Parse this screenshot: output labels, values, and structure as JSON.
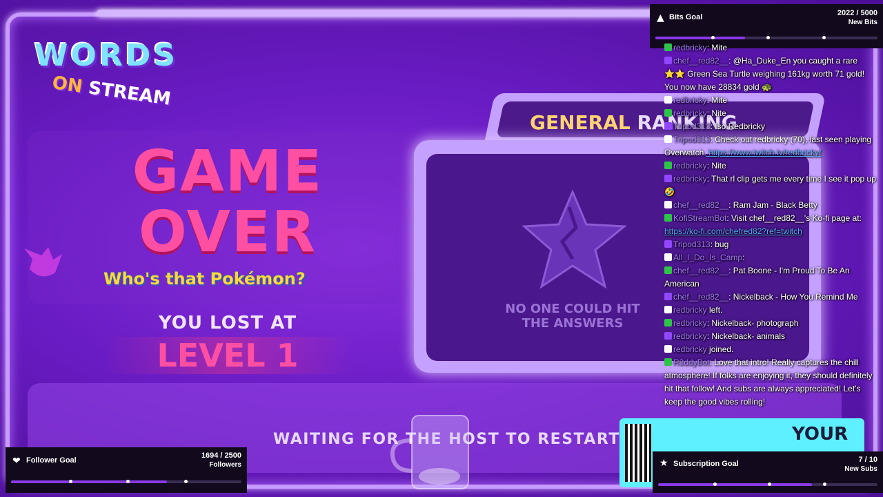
{
  "logo": {
    "line1": "WORDS",
    "line2a": "ON",
    "line2b": "STREAM"
  },
  "game": {
    "title": "GAME OVER",
    "overlay_text": "Who's that Pokémon?",
    "lost_at": "YOU LOST AT",
    "level": "LEVEL 1",
    "waiting": "WAITING FOR THE HOST TO RESTART"
  },
  "ranking": {
    "title_a": "GENERAL",
    "title_b": "RANKING",
    "empty": "NO ONE COULD HIT THE ANSWERS"
  },
  "qr_promo": {
    "text": "YOUR"
  },
  "goals": {
    "bits": {
      "label": "Bits Goal",
      "value": "2022 / 5000",
      "sub": "New Bits",
      "progress": 0.4044,
      "icon": "bits-triangle-icon"
    },
    "followers": {
      "label": "Follower Goal",
      "value": "1694 / 2500",
      "sub": "Followers",
      "progress": 0.6776,
      "icon": "heart-icon"
    },
    "subs": {
      "label": "Subscription Goal",
      "value": "7 / 10",
      "sub": "New Subs",
      "progress": 0.7,
      "icon": "star-icon"
    }
  },
  "chat": [
    {
      "user": "redbricky",
      "text": ": Mite"
    },
    {
      "user": "chef__red82__",
      "text": ": @Ha_Duke_En you caught a rare ⭐⭐ Green Sea Turtle weighing 161kg worth 71 gold! You now have 28834 gold 🐢"
    },
    {
      "user": "redbricky",
      "text": ": Mite"
    },
    {
      "user": "redbricky",
      "text": ": Nite"
    },
    {
      "user": "Tripod313",
      "text": ": Iso Redbricky"
    },
    {
      "user": "Tripod313",
      "text": ": Check out redbricky (70), last seen playing Overwatch.",
      "link": "https://www.twitch.tv/redbricky/"
    },
    {
      "user": "redbricky",
      "text": ": Nite"
    },
    {
      "user": "redbricky",
      "text": ": That rl clip gets me every time I see it pop up 🤣"
    },
    {
      "user": "chef__red82__",
      "text": ": Ram Jam - Black Betty"
    },
    {
      "user": "KofiStreamBot",
      "text": ": Visit chef__red82__'s Ko-fi page at:",
      "link": "https://ko-fi.com/chefred82?ref=twitch"
    },
    {
      "user": "Tripod313",
      "text": ": bug"
    },
    {
      "user": "All_I_Do_Is_Camp",
      "text": ": "
    },
    {
      "user": "chef__red82__",
      "text": ": Pat Boone - I'm Proud To Be An American"
    },
    {
      "user": "chef__red82__",
      "text": ": Nickelback - How You Remind Me"
    },
    {
      "user": "redbricky",
      "text": " left."
    },
    {
      "user": "redbricky",
      "text": ": Nickelback- photograph"
    },
    {
      "user": "redbricky",
      "text": ": Nickelback- animals"
    },
    {
      "user": "redbricky",
      "text": " joined."
    },
    {
      "user": "R3ddyBot",
      "text": ": Love that intro! Really captures the chill atmosphere! If folks are enjoying it, they should definitely hit that follow! And subs are always appreciated! Let's keep the good vibes rolling!"
    }
  ]
}
